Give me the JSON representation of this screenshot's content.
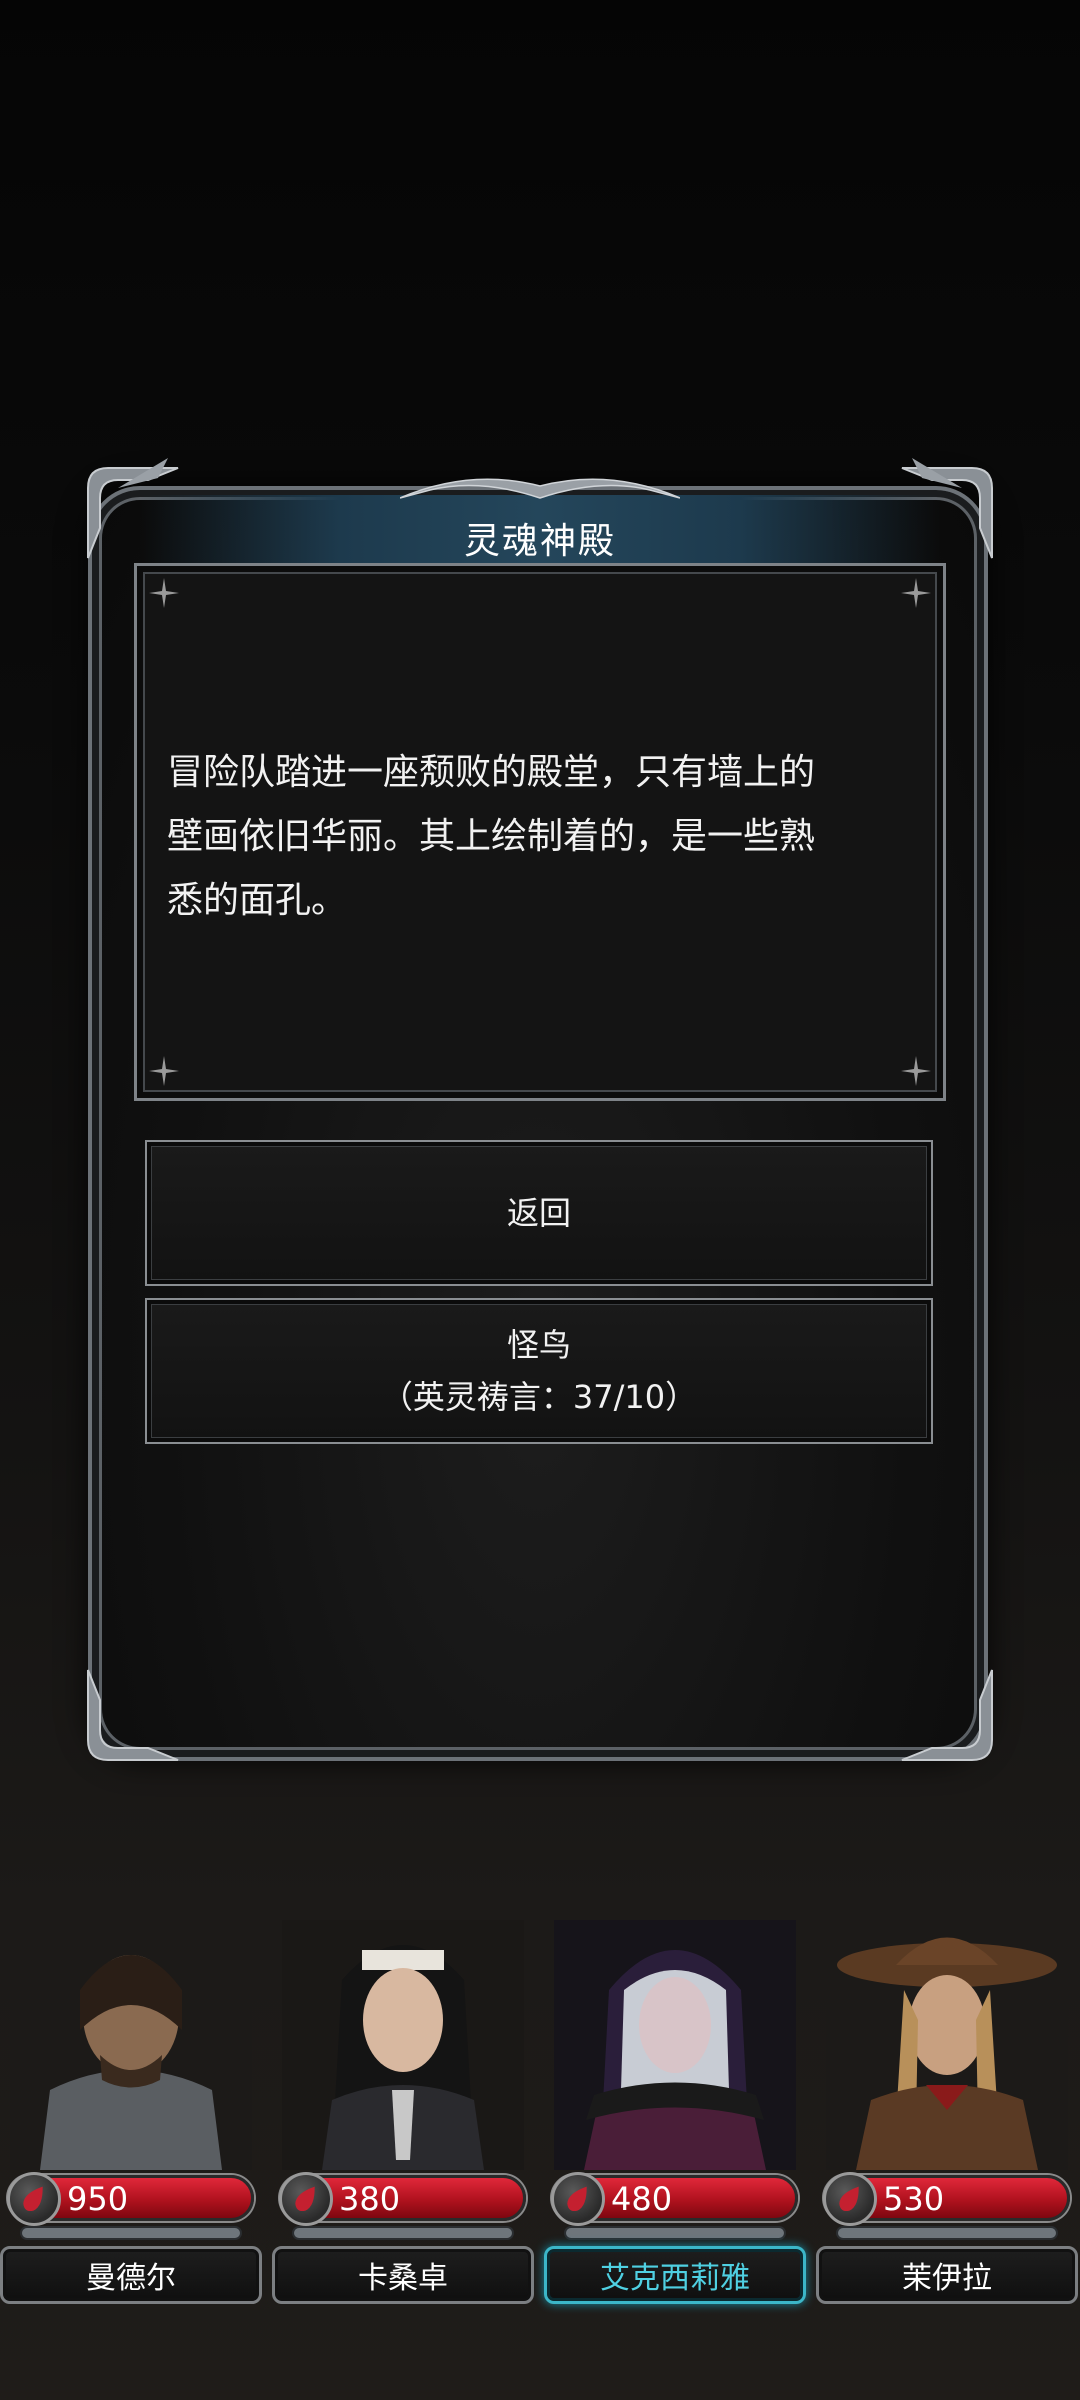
{
  "dialog": {
    "title": "灵魂神殿",
    "story_lines": [
      "冒险队踏进一座颓败的殿堂，只有墙上的",
      "壁画依旧华丽。其上绘制着的，是一些熟",
      "悉的面孔。"
    ],
    "options": [
      {
        "label": "返回"
      },
      {
        "label": "怪鸟",
        "sub_label": "（英灵祷言：37/10）"
      }
    ]
  },
  "party": [
    {
      "name": "曼德尔",
      "hp": "950",
      "active": false
    },
    {
      "name": "卡桑卓",
      "hp": "380",
      "active": false
    },
    {
      "name": "艾克西莉雅",
      "hp": "480",
      "active": true
    },
    {
      "name": "茉伊拉",
      "hp": "530",
      "active": false
    }
  ],
  "colors": {
    "hp_red": "#c4192a",
    "active_name": "#4fd0e2",
    "frame_silver": "#6c7278",
    "title_banner": "#24465b"
  },
  "icons": {
    "hp": "blood-drop-icon",
    "ornament": "gothic-corner-ornament"
  }
}
